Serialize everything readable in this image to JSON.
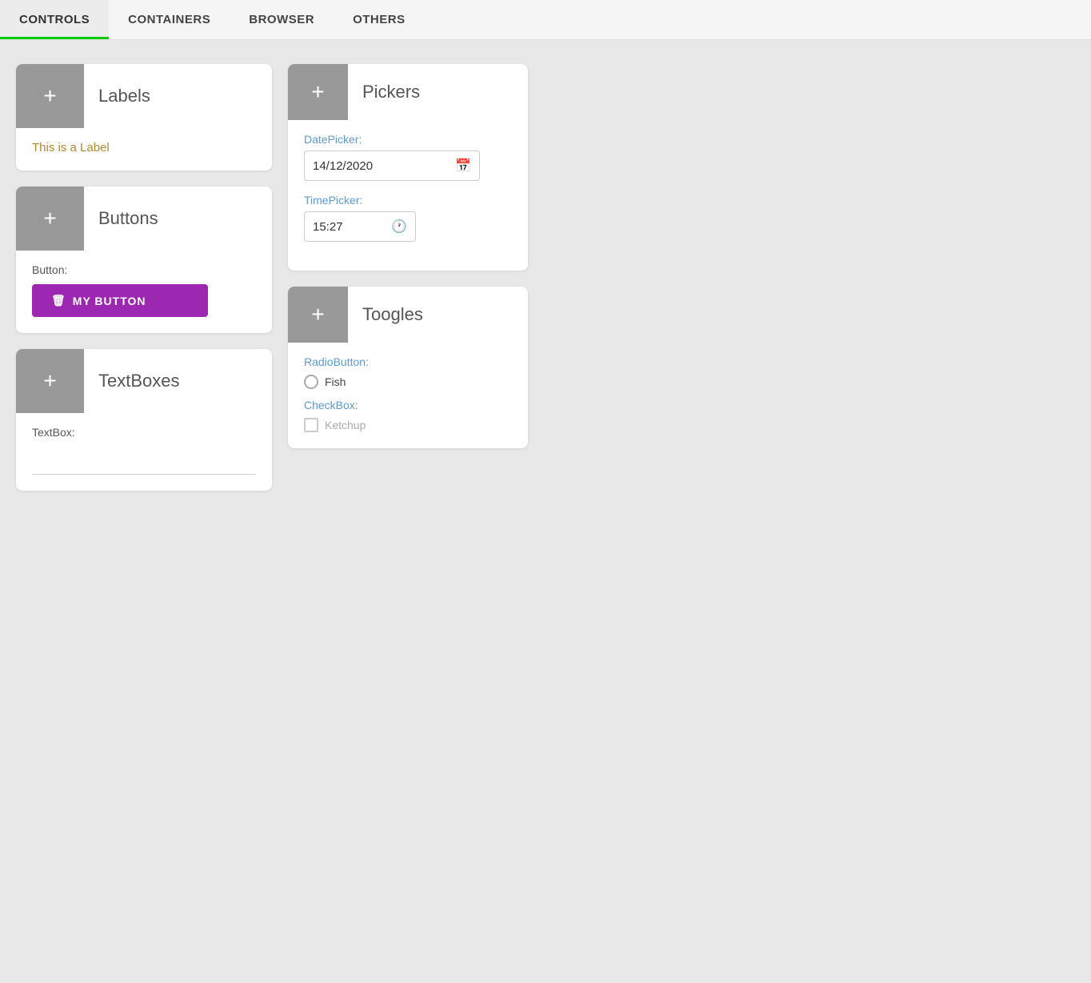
{
  "nav": {
    "items": [
      {
        "id": "controls",
        "label": "CONTROLS",
        "active": true
      },
      {
        "id": "containers",
        "label": "CONTAINERS",
        "active": false
      },
      {
        "id": "browser",
        "label": "BROWSER",
        "active": false
      },
      {
        "id": "others",
        "label": "OTHERS",
        "active": false
      }
    ]
  },
  "cards": {
    "labels": {
      "icon": "+",
      "title": "Labels",
      "content": "This is a Label"
    },
    "buttons": {
      "icon": "+",
      "title": "Buttons",
      "field_label": "Button:",
      "button_label": "MY BUTTON"
    },
    "textboxes": {
      "icon": "+",
      "title": "TextBoxes",
      "field_label": "TextBox:",
      "placeholder": ""
    },
    "pickers": {
      "icon": "+",
      "title": "Pickers",
      "datepicker_label": "DatePicker:",
      "datepicker_value": "14/12/2020",
      "timepicker_label": "TimePicker:",
      "timepicker_value": "15:27"
    },
    "toggles": {
      "icon": "+",
      "title": "Toogles",
      "radiobutton_label": "RadioButton:",
      "radio_option": "Fish",
      "checkbox_label": "CheckBox:",
      "checkbox_option": "Ketchup"
    }
  }
}
